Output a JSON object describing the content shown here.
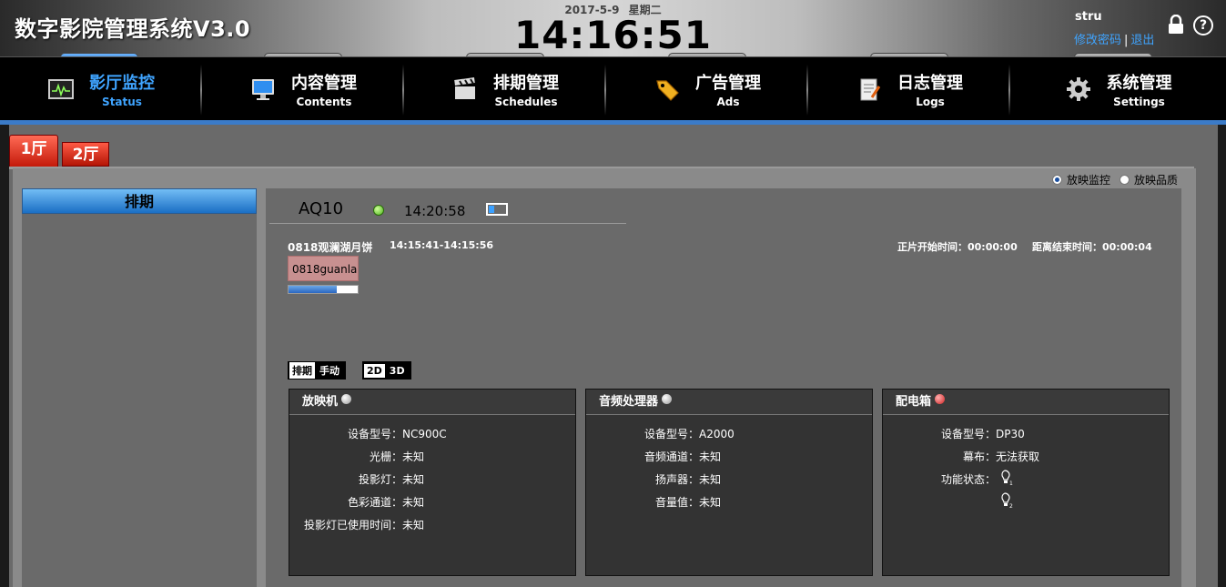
{
  "header": {
    "app_title": "数字影院管理系统V3.0",
    "date": "2017-5-9",
    "weekday": "星期二",
    "clock": "14:16:51",
    "user": "stru",
    "change_password": "修改密码",
    "separator": "|",
    "logout": "退出"
  },
  "nav": [
    {
      "cn": "影厅监控",
      "en": "Status",
      "icon": "monitor-chart-icon",
      "active": true
    },
    {
      "cn": "内容管理",
      "en": "Contents",
      "icon": "computer-icon",
      "active": false
    },
    {
      "cn": "排期管理",
      "en": "Schedules",
      "icon": "clapperboard-icon",
      "active": false
    },
    {
      "cn": "广告管理",
      "en": "Ads",
      "icon": "tag-icon",
      "active": false
    },
    {
      "cn": "日志管理",
      "en": "Logs",
      "icon": "notepad-icon",
      "active": false
    },
    {
      "cn": "系统管理",
      "en": "Settings",
      "icon": "gear-icon",
      "active": false
    }
  ],
  "halls": [
    "1厅",
    "2厅"
  ],
  "view_options": {
    "monitor": "放映监控",
    "quality": "放映品质",
    "selected": "monitor"
  },
  "schedule_panel": {
    "title": "排期"
  },
  "device": {
    "name": "AQ10",
    "time": "14:20:58",
    "status_color": "#4cb21c"
  },
  "show": {
    "title": "0818观澜湖月饼",
    "range": "14:15:41-14:15:56",
    "start_label": "正片开始时间：00:00:00",
    "end_label": "距离结束时间：00:00:04",
    "content_name": "0818guanla",
    "progress_percent": 70
  },
  "modes": {
    "schedule": {
      "on": "排期",
      "off": "手动"
    },
    "dimension": {
      "on": "2D",
      "off": "3D"
    }
  },
  "projector": {
    "title": "放映机",
    "status": "gray",
    "rows": [
      {
        "label": "设备型号：",
        "value": "NC900C"
      },
      {
        "label": "光栅：",
        "value": "未知"
      },
      {
        "label": "投影灯：",
        "value": "未知"
      },
      {
        "label": "色彩通道：",
        "value": "未知"
      },
      {
        "label": "投影灯已使用时间：",
        "value": "未知"
      }
    ]
  },
  "audio": {
    "title": "音频处理器",
    "status": "gray",
    "rows": [
      {
        "label": "设备型号：",
        "value": "A2000"
      },
      {
        "label": "音频通道：",
        "value": "未知"
      },
      {
        "label": "扬声器：",
        "value": "未知"
      },
      {
        "label": "音量值：",
        "value": "未知"
      }
    ]
  },
  "power": {
    "title": "配电箱",
    "status": "red",
    "rows": [
      {
        "label": "设备型号：",
        "value": "DP30"
      },
      {
        "label": "幕布：",
        "value": "无法获取"
      },
      {
        "label": "功能状态：",
        "value": ""
      }
    ],
    "bulbs": [
      "1",
      "2"
    ]
  }
}
